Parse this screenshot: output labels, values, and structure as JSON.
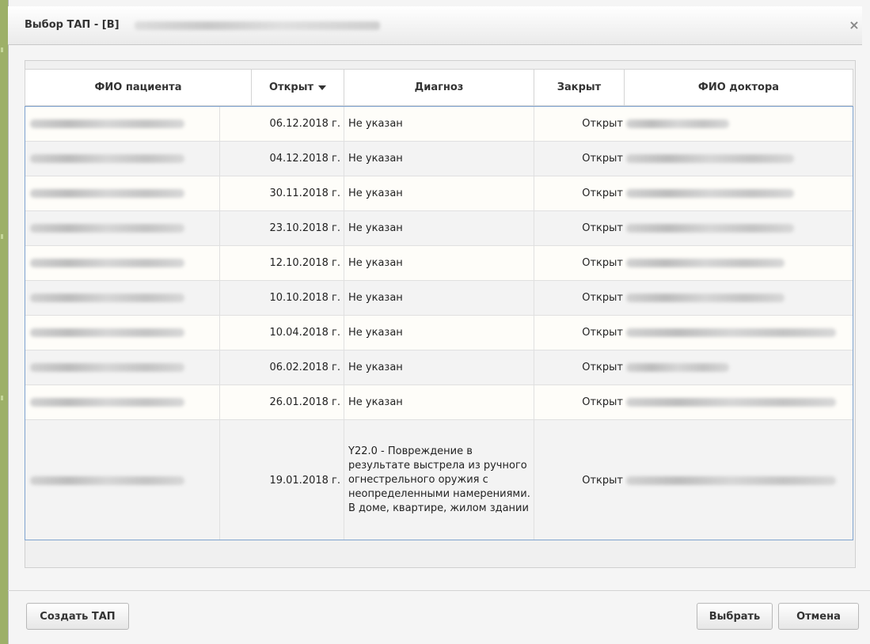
{
  "dialog": {
    "title": "Выбор ТАП - [В]",
    "close_icon": "×"
  },
  "table": {
    "columns": [
      "ФИО пациента",
      "Открыт",
      "Диагноз",
      "Закрыт",
      "ФИО доктора"
    ],
    "sorted_column": "Открыт",
    "sort_direction": "descending",
    "rows": [
      {
        "opened": "06.12.2018 г.",
        "diagnosis": "Не указан",
        "closed": "Открыт"
      },
      {
        "opened": "04.12.2018 г.",
        "diagnosis": "Не указан",
        "closed": "Открыт"
      },
      {
        "opened": "30.11.2018 г.",
        "diagnosis": "Не указан",
        "closed": "Открыт"
      },
      {
        "opened": "23.10.2018 г.",
        "diagnosis": "Не указан",
        "closed": "Открыт"
      },
      {
        "opened": "12.10.2018 г.",
        "diagnosis": "Не указан",
        "closed": "Открыт"
      },
      {
        "opened": "10.10.2018 г.",
        "diagnosis": "Не указан",
        "closed": "Открыт"
      },
      {
        "opened": "10.04.2018 г.",
        "diagnosis": "Не указан",
        "closed": "Открыт"
      },
      {
        "opened": "06.02.2018 г.",
        "diagnosis": "Не указан",
        "closed": "Открыт"
      },
      {
        "opened": "26.01.2018 г.",
        "diagnosis": "Не указан",
        "closed": "Открыт"
      },
      {
        "opened": "19.01.2018 г.",
        "diagnosis": "Y22.0 - Повреждение в результате выстрела из ручного огнестрельного оружия с неопределенными намерениями. В доме, квартире, жилом здании",
        "closed": "Открыт"
      }
    ]
  },
  "buttons": {
    "create": "Создать ТАП",
    "choose": "Выбрать",
    "cancel": "Отмена"
  }
}
